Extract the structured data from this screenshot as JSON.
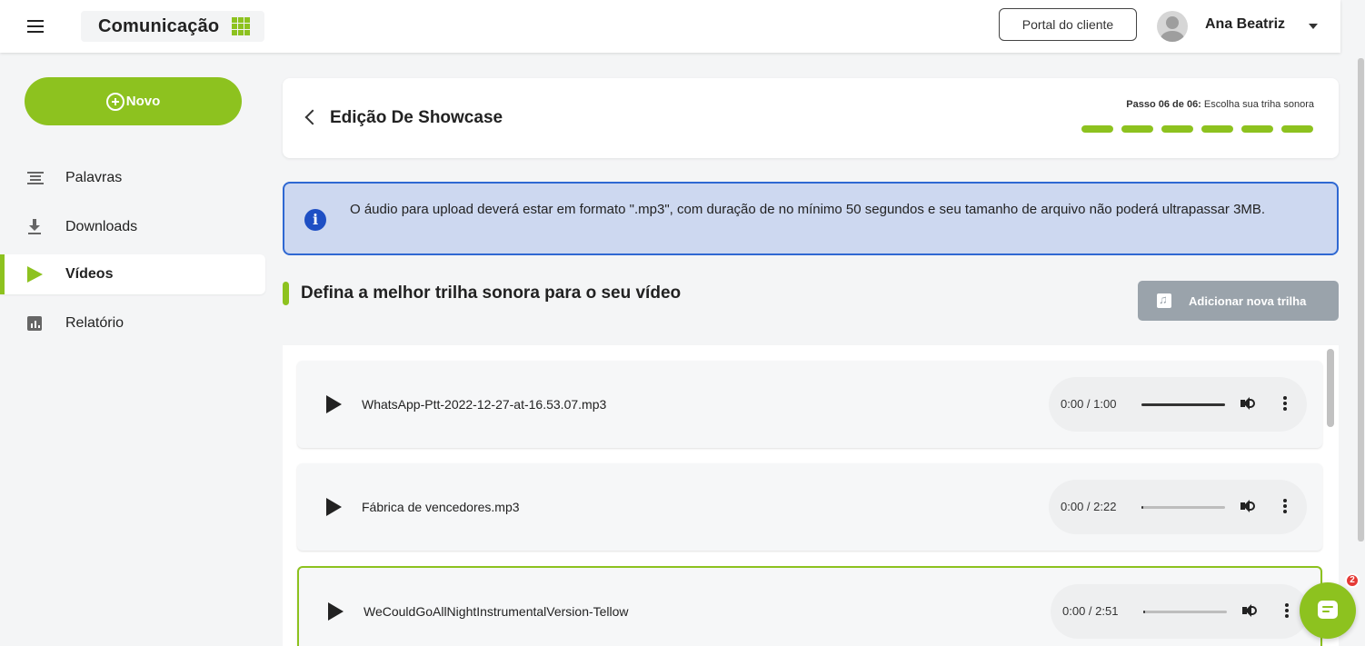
{
  "topbar": {
    "app_name": "Comunicação",
    "portal_button": "Portal do cliente",
    "user_name": "Ana Beatriz"
  },
  "sidebar": {
    "new_button": "Novo",
    "items": [
      {
        "label": "Palavras",
        "icon": "lines-icon",
        "active": false
      },
      {
        "label": "Downloads",
        "icon": "download-icon",
        "active": false
      },
      {
        "label": "Vídeos",
        "icon": "play-icon",
        "active": true
      },
      {
        "label": "Relatório",
        "icon": "chart-icon",
        "active": false
      }
    ]
  },
  "header": {
    "title": "Edição De Showcase",
    "step_prefix": "Passo 06 de 06:",
    "step_label": "Escolha sua triha sonora",
    "steps_total": 6,
    "steps_done": 6
  },
  "info": {
    "text": "O áudio para upload deverá estar em formato \".mp3\", com duração de no mínimo 50 segundos e seu tamanho de arquivo não poderá ultrapassar 3MB."
  },
  "section": {
    "title": "Defina a melhor trilha sonora para o seu vídeo",
    "add_button": "Adicionar nova trilha"
  },
  "tracks": [
    {
      "name": "WhatsApp-Ptt-2022-12-27-at-16.53.07.mp3",
      "time": "0:00 / 1:00",
      "progress": 1.0,
      "selected": false
    },
    {
      "name": "Fábrica de vencedores.mp3",
      "time": "0:00 / 2:22",
      "progress": 0.02,
      "selected": false
    },
    {
      "name": "WeCouldGoAllNightInstrumentalVersion-Tellow",
      "time": "0:00 / 2:51",
      "progress": 0.02,
      "selected": true
    }
  ],
  "chat": {
    "badge_count": "2"
  },
  "colors": {
    "accent": "#8dc21f",
    "info_bg": "#cdd8f0",
    "info_border": "#2f68d2",
    "disabled_button": "#9aa3ab"
  }
}
